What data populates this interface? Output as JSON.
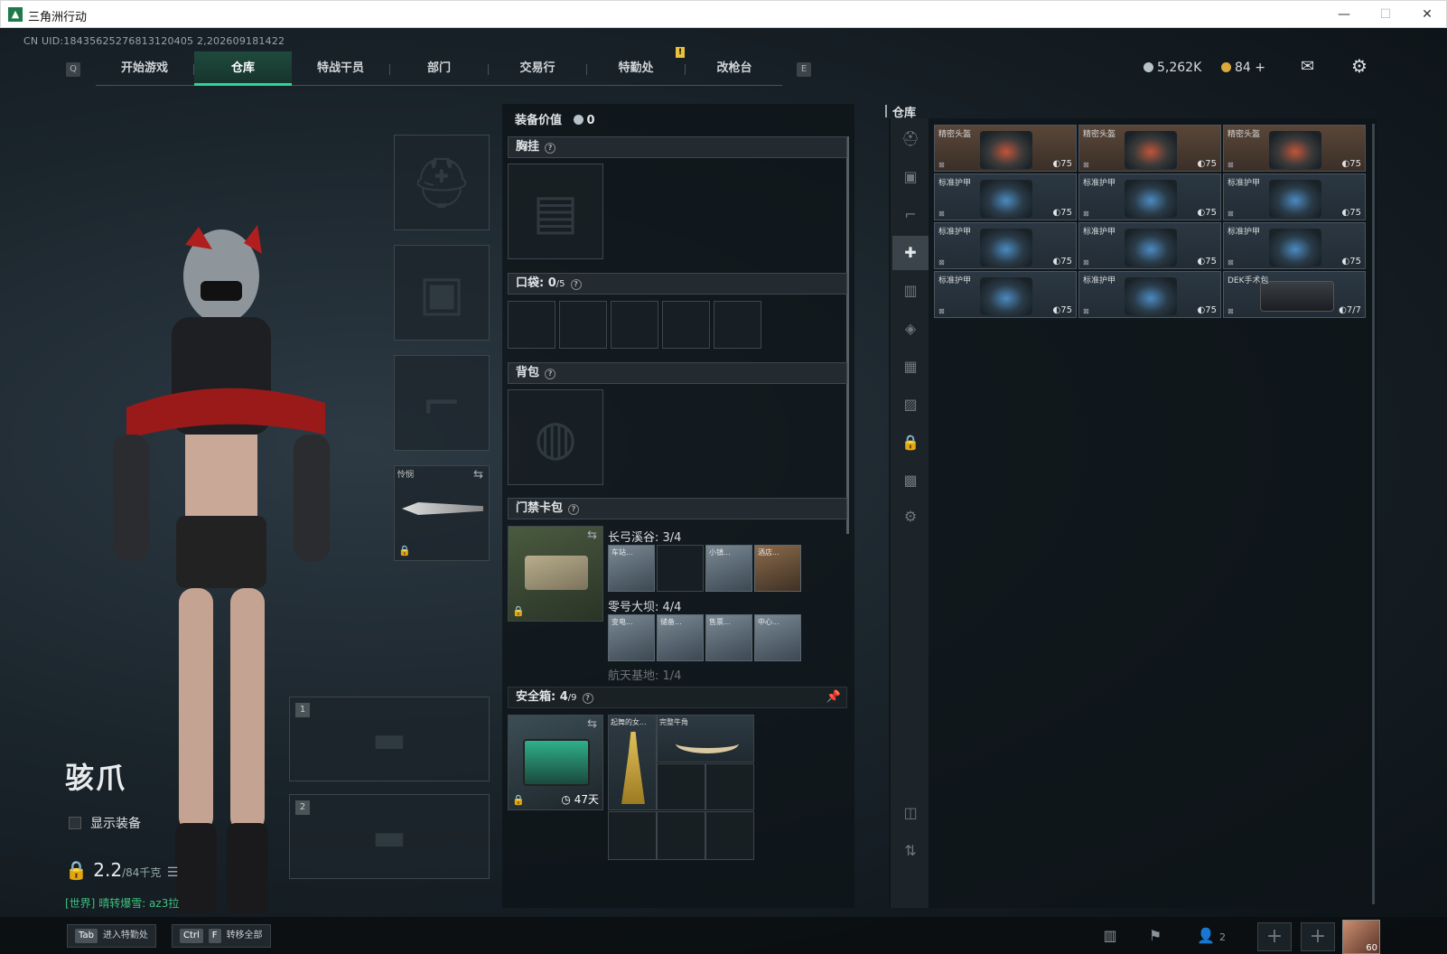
{
  "window": {
    "title": "三角洲行动",
    "minimize": "—",
    "maximize": "☐",
    "close": "✕"
  },
  "uid": "CN UID:18435625276813120405 2,202609181422",
  "nav": {
    "left_key": "Q",
    "right_key": "E",
    "tabs": [
      {
        "label": "开始游戏"
      },
      {
        "label": "仓库",
        "active": true
      },
      {
        "label": "特战干员"
      },
      {
        "label": "部门"
      },
      {
        "label": "交易行"
      },
      {
        "label": "特勤处"
      },
      {
        "label": "改枪台"
      }
    ],
    "alert": "!"
  },
  "currency": {
    "coins": "5,262K",
    "tokens": "84",
    "plus": "+",
    "coin_color": "#b7c3c9",
    "token_color": "#d9a93a"
  },
  "character": {
    "name": "骇爪",
    "show_equipment": "显示装备",
    "weight": "2.2",
    "weight_max": "/84千克",
    "chat_channel": "[世界]",
    "chat_user": "晴转爆雪: az3拉"
  },
  "loadout": {
    "melee_label": "怜悯",
    "weapon_slot_1": "1",
    "weapon_slot_2": "2"
  },
  "equipment": {
    "value_label": "装备价值",
    "value": "0",
    "chest_rig": "胸挂",
    "pocket": "口袋:",
    "pocket_count": "0",
    "pocket_max": "/5",
    "backpack": "背包",
    "keycard": "门禁卡包",
    "keycard_groups": [
      {
        "title": "长弓溪谷: 3/4",
        "cards": [
          "车站...",
          "",
          "小镇...",
          "酒店..."
        ]
      },
      {
        "title": "零号大坝: 4/4",
        "cards": [
          "变电...",
          "储备...",
          "售票...",
          "中心..."
        ]
      },
      {
        "title": "航天基地: 1/4",
        "cards": []
      }
    ],
    "safebox": "安全箱:",
    "safebox_count": "4",
    "safebox_max": "/9",
    "safebox_days": "47天",
    "safebox_items": [
      "起舞的女...",
      "完整牛角"
    ]
  },
  "warehouse": {
    "title": "仓库",
    "items": [
      {
        "name": "精密头盔",
        "dur": "75",
        "kind": "helmet"
      },
      {
        "name": "精密头盔",
        "dur": "75",
        "kind": "helmet"
      },
      {
        "name": "精密头盔",
        "dur": "75",
        "kind": "helmet"
      },
      {
        "name": "标准护甲",
        "dur": "75",
        "kind": "armor"
      },
      {
        "name": "标准护甲",
        "dur": "75",
        "kind": "armor"
      },
      {
        "name": "标准护甲",
        "dur": "75",
        "kind": "armor"
      },
      {
        "name": "标准护甲",
        "dur": "75",
        "kind": "armor"
      },
      {
        "name": "标准护甲",
        "dur": "75",
        "kind": "armor"
      },
      {
        "name": "标准护甲",
        "dur": "75",
        "kind": "armor"
      },
      {
        "name": "标准护甲",
        "dur": "75",
        "kind": "armor"
      },
      {
        "name": "标准护甲",
        "dur": "75",
        "kind": "armor"
      },
      {
        "name": "DEK手术包",
        "dur": "7/7",
        "kind": "case"
      }
    ]
  },
  "bottom": {
    "tab_key": "Tab",
    "tab_hint": "进入特勤处",
    "ctrl_key": "Ctrl",
    "f_key": "F",
    "transfer_hint": "转移全部",
    "friends": "2",
    "level": "60"
  }
}
